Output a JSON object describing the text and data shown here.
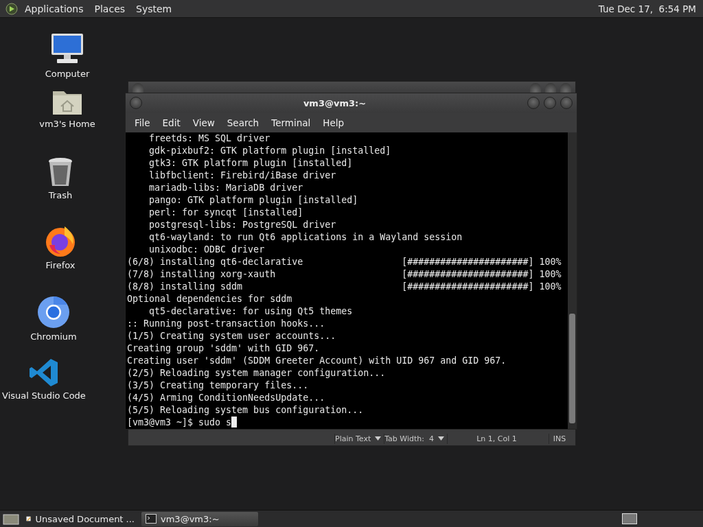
{
  "top_panel": {
    "menus": [
      "Applications",
      "Places",
      "System"
    ],
    "clock": "Tue Dec 17,  6:54 PM"
  },
  "desktop_icons": [
    {
      "label": "Computer",
      "kind": "computer"
    },
    {
      "label": "vm3's Home",
      "kind": "home"
    },
    {
      "label": "Trash",
      "kind": "trash"
    },
    {
      "label": "Firefox",
      "kind": "firefox"
    },
    {
      "label": "Chromium",
      "kind": "chromium"
    },
    {
      "label": "Visual Studio Code",
      "kind": "vscode"
    }
  ],
  "editor_window": {
    "status_bar": {
      "language": "Plain Text",
      "tab_width": "Tab Width:  4",
      "position": "Ln 1, Col 1",
      "mode": "INS"
    }
  },
  "terminal_window": {
    "title": "vm3@vm3:~",
    "menu": [
      "File",
      "Edit",
      "View",
      "Search",
      "Terminal",
      "Help"
    ],
    "lines": [
      "    freetds: MS SQL driver",
      "    gdk-pixbuf2: GTK platform plugin [installed]",
      "    gtk3: GTK platform plugin [installed]",
      "    libfbclient: Firebird/iBase driver",
      "    mariadb-libs: MariaDB driver",
      "    pango: GTK platform plugin [installed]",
      "    perl: for syncqt [installed]",
      "    postgresql-libs: PostgreSQL driver",
      "    qt6-wayland: to run Qt6 applications in a Wayland session",
      "    unixodbc: ODBC driver",
      "(6/8) installing qt6-declarative                  [######################] 100%",
      "(7/8) installing xorg-xauth                       [######################] 100%",
      "(8/8) installing sddm                             [######################] 100%",
      "Optional dependencies for sddm",
      "    qt5-declarative: for using Qt5 themes",
      ":: Running post-transaction hooks...",
      "(1/5) Creating system user accounts...",
      "Creating group 'sddm' with GID 967.",
      "Creating user 'sddm' (SDDM Greeter Account) with UID 967 and GID 967.",
      "(2/5) Reloading system manager configuration...",
      "(3/5) Creating temporary files...",
      "(4/5) Arming ConditionNeedsUpdate...",
      "(5/5) Reloading system bus configuration..."
    ],
    "prompt": "[vm3@vm3 ~]$ sudo s"
  },
  "taskbar": {
    "items": [
      {
        "label": "Unsaved Document ...",
        "kind": "editor",
        "selected": false
      },
      {
        "label": "vm3@vm3:~",
        "kind": "terminal",
        "selected": true
      }
    ]
  }
}
